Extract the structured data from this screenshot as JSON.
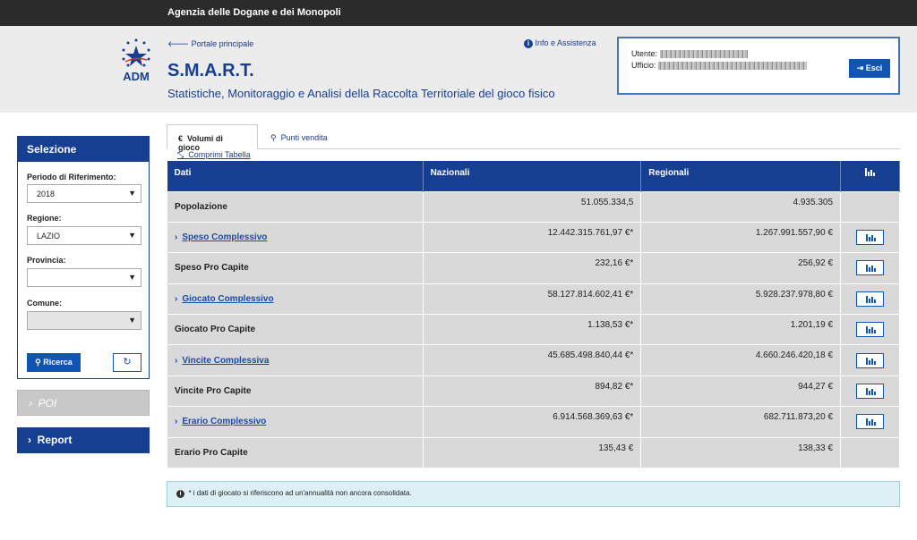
{
  "topbar": {
    "org": "Agenzia delle Dogane e dei Monopoli"
  },
  "header": {
    "logo_text": "ADM",
    "back_link": "Portale principale",
    "title": "S.M.A.R.T.",
    "subtitle": "Statistiche, Monitoraggio e Analisi della Raccolta Territoriale del gioco fisico",
    "info_link": "Info e Assistenza",
    "user_label": "Utente:",
    "office_label": "Ufficio:",
    "logout_label": "Esci"
  },
  "sidebar": {
    "title": "Selezione",
    "period_label": "Periodo di Riferimento:",
    "period_value": "2018",
    "region_label": "Regione:",
    "region_value": "LAZIO",
    "province_label": "Provincia:",
    "province_value": "",
    "comune_label": "Comune:",
    "comune_value": "",
    "search_label": "Ricerca",
    "poi_label": "POI",
    "report_label": "Report"
  },
  "tabs": [
    {
      "label": "Volumi di gioco",
      "icon": "euro-icon",
      "active": true
    },
    {
      "label": "Punti vendita",
      "icon": "map-marker-icon",
      "active": false
    }
  ],
  "collapse_link": "Comprimi Tabella",
  "table": {
    "headers": [
      "Dati",
      "Nazionali",
      "Regionali"
    ],
    "rows": [
      {
        "label": "Popolazione",
        "nazionali": "51.055.334,5",
        "regionali": "4.935.305",
        "link": false,
        "chart": false
      },
      {
        "label": "Speso Complessivo",
        "nazionali": "12.442.315.761,97 €*",
        "regionali": "1.267.991.557,90 €",
        "link": true,
        "chart": true
      },
      {
        "label": "Speso Pro Capite",
        "nazionali": "232,16 €*",
        "regionali": "256,92 €",
        "link": false,
        "chart": true
      },
      {
        "label": "Giocato Complessivo",
        "nazionali": "58.127.814.602,41 €*",
        "regionali": "5.928.237.978,80 €",
        "link": true,
        "chart": true
      },
      {
        "label": "Giocato Pro Capite",
        "nazionali": "1.138,53 €*",
        "regionali": "1.201,19 €",
        "link": false,
        "chart": true
      },
      {
        "label": "Vincite Complessiva",
        "nazionali": "45.685.498.840,44 €*",
        "regionali": "4.660.246.420,18 €",
        "link": true,
        "chart": true
      },
      {
        "label": "Vincite Pro Capite",
        "nazionali": "894,82 €*",
        "regionali": "944,27 €",
        "link": false,
        "chart": true
      },
      {
        "label": "Erario Complessivo",
        "nazionali": "6.914.568.369,63 €*",
        "regionali": "682.711.873,20 €",
        "link": true,
        "chart": true
      },
      {
        "label": "Erario Pro Capite",
        "nazionali": "135,43 €",
        "regionali": "138,33 €",
        "link": false,
        "chart": false
      }
    ]
  },
  "footnote": "* i dati di giocato si riferiscono ad un'annualità non ancora consolidata.",
  "colors": {
    "primary": "#163f91",
    "button": "#1055b3",
    "topbar": "#2b2b2b",
    "header_bg": "#ececec",
    "row_bg": "#d9d9d9",
    "note_bg": "#ddf0f6"
  }
}
